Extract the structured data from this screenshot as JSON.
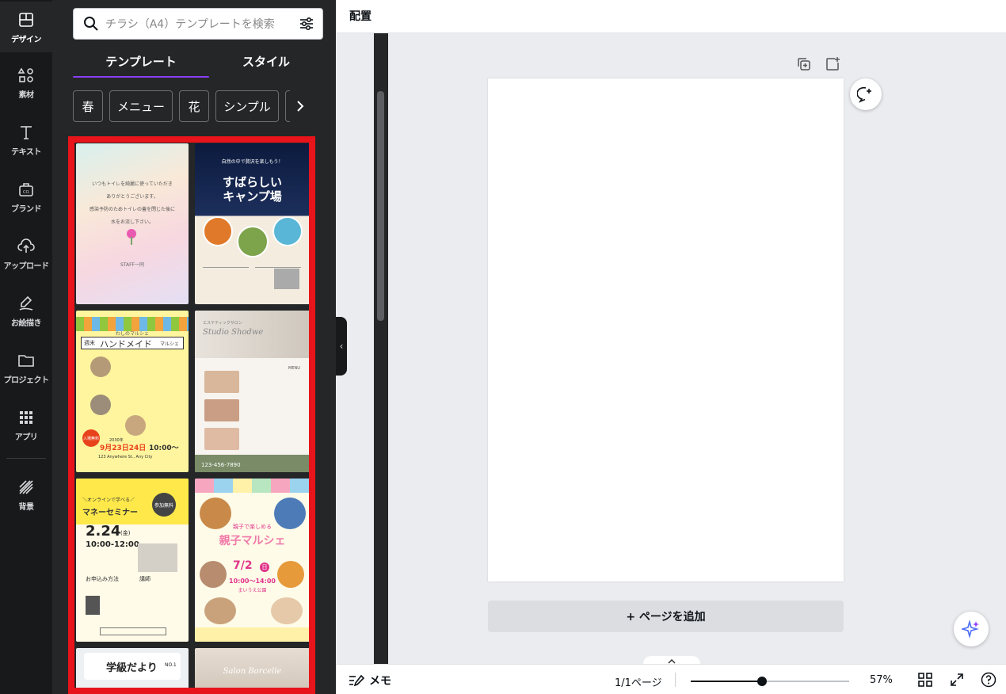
{
  "rail": {
    "items": [
      {
        "label": "デザイン",
        "icon": "layout-icon"
      },
      {
        "label": "素材",
        "icon": "shapes-icon"
      },
      {
        "label": "テキスト",
        "icon": "text-icon"
      },
      {
        "label": "ブランド",
        "icon": "brand-icon"
      },
      {
        "label": "アップロード",
        "icon": "upload-icon"
      },
      {
        "label": "お絵描き",
        "icon": "draw-icon"
      },
      {
        "label": "プロジェクト",
        "icon": "folder-icon"
      },
      {
        "label": "アプリ",
        "icon": "apps-icon"
      },
      {
        "label": "背景",
        "icon": "background-icon"
      }
    ]
  },
  "panel": {
    "search_placeholder": "チラシ（A4）テンプレートを検索",
    "tabs": [
      "テンプレート",
      "スタイル"
    ],
    "chips": [
      "春",
      "メニュー",
      "花",
      "シンプル",
      "セ"
    ]
  },
  "templates": [
    {
      "name": "restroom-notice",
      "lines": [
        "いつもトイレを綺麗に使っていただき",
        "ありがとうございます。",
        "感染予防のためトイレの蓋を閉じた後に",
        "水をお流し下さい。",
        "STAFF一同"
      ]
    },
    {
      "name": "camp",
      "lines": [
        "自然の中で贅沢を楽しもう！",
        "すばらしい",
        "キャンプ場"
      ]
    },
    {
      "name": "handmade-marche",
      "lines": [
        "わしのマルシェ",
        "週末",
        "ハンドメイド",
        "マルシェ",
        "入場無料",
        "2030年",
        "9月23日24日",
        "10:00〜",
        "123 Anywhere St., Any City"
      ]
    },
    {
      "name": "salon",
      "lines": [
        "エステティックサロン",
        "Studio Shodwe",
        "MENU",
        "123-456-7890"
      ]
    },
    {
      "name": "money-seminar",
      "lines": [
        "＼オンラインで学べる／",
        "マネーセミナー",
        "参加無料",
        "2.24",
        "(金)",
        "10:00-12:00",
        "お申込み方法",
        "講師"
      ]
    },
    {
      "name": "kids-marche",
      "lines": [
        "親子で楽しめる",
        "親子マルシェ",
        "7/2",
        "日",
        "10:00〜14:00",
        "まいうえ公園"
      ]
    },
    {
      "name": "class-newsletter",
      "lines": [
        "学級だより",
        "NO.1"
      ]
    },
    {
      "name": "salon-borcelle",
      "lines": [
        "Salon Borcelle"
      ]
    }
  ],
  "editor": {
    "title": "配置",
    "add_page": "+ ページを追加",
    "memo": "メモ",
    "pages": "1/1ページ",
    "zoom_label": "57%",
    "zoom_value": 0.45
  },
  "colors": {
    "accent": "#8b3dff",
    "highlight": "#e8141b",
    "rail": "#18191b",
    "panel": "#252627"
  }
}
